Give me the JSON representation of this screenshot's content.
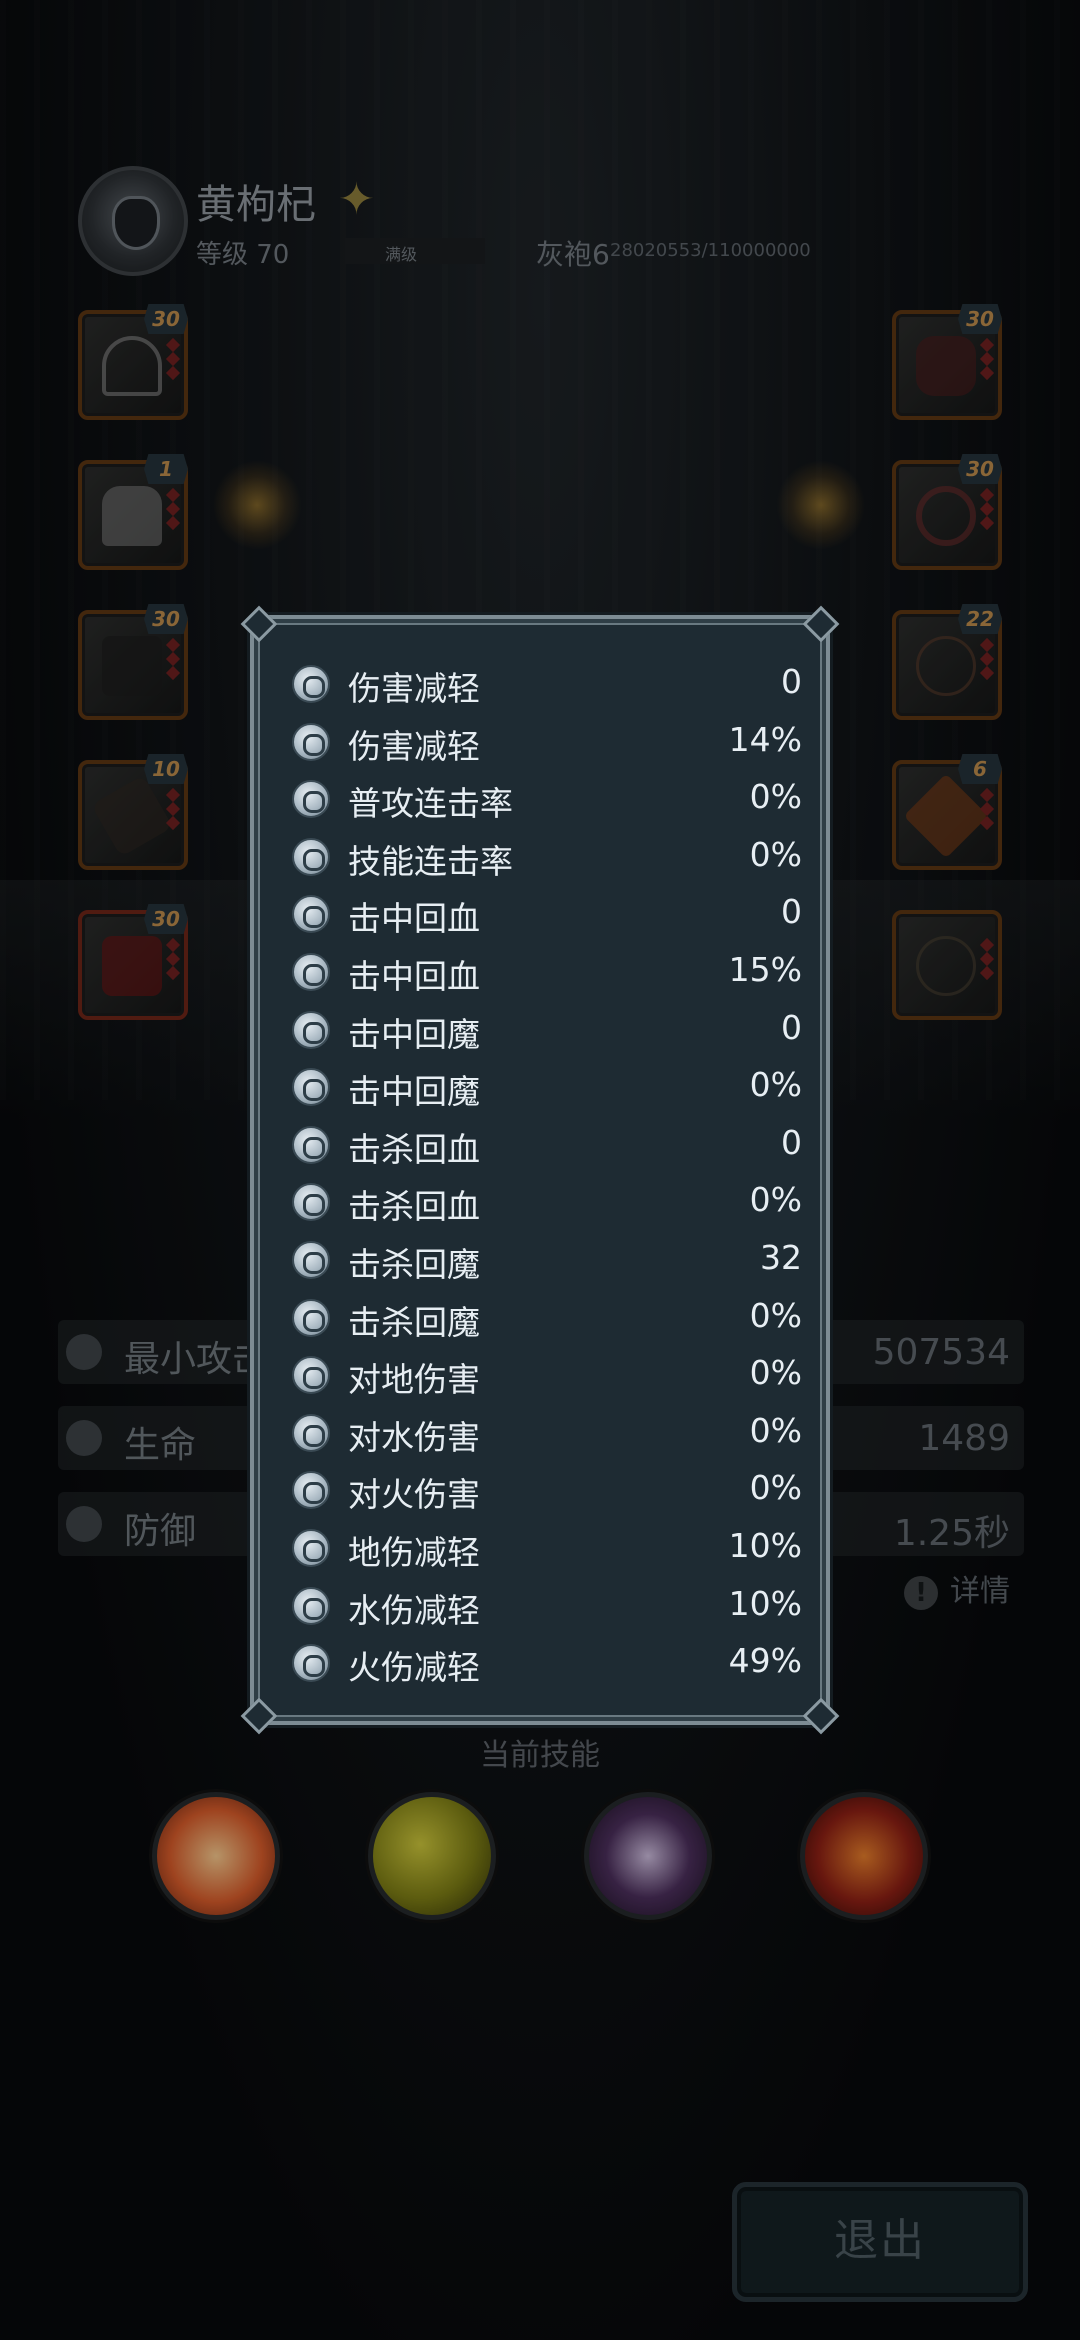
{
  "player": {
    "name": "黄枸杞",
    "level": "等级 70",
    "level_bar": "满级",
    "exp_label": "灰袍6",
    "exp_value": "28020553/110000000"
  },
  "equipment": {
    "left": [
      {
        "level": "30",
        "item": "hood-icon"
      },
      {
        "level": "1",
        "item": "character-icon"
      },
      {
        "level": "30",
        "item": "boots-icon"
      },
      {
        "level": "10",
        "item": "glove-icon"
      },
      {
        "level": "30",
        "item": "armor-icon"
      }
    ],
    "right": [
      {
        "level": "30",
        "item": "weapon-icon"
      },
      {
        "level": "30",
        "item": "ring-icon"
      },
      {
        "level": "22",
        "item": "necklace-icon"
      },
      {
        "level": "6",
        "item": "emblem-icon"
      },
      {
        "level": "",
        "item": "amulet-icon"
      }
    ]
  },
  "background_stats": [
    {
      "label": "最小攻击",
      "value": "507534",
      "icon": "sword-icon"
    },
    {
      "label": "生命",
      "value": "1489",
      "icon": "heart-icon"
    },
    {
      "label": "防御",
      "value": "1.25秒",
      "icon": "shield-icon"
    }
  ],
  "detail_label": "详情",
  "skills_title": "当前技能",
  "skills": [
    {
      "icon": "explosion-skill-icon",
      "color": "#c8502a"
    },
    {
      "icon": "bubbles-skill-icon",
      "color": "#6f7a14"
    },
    {
      "icon": "shadow-strike-skill-icon",
      "color": "#3a2a4a"
    },
    {
      "icon": "fire-shield-skill-icon",
      "color": "#7a1f14"
    }
  ],
  "exit_label": "退出",
  "attributes": [
    {
      "label": "伤害减轻",
      "value": "0",
      "icon": "armor-reduce-icon"
    },
    {
      "label": "伤害减轻",
      "value": "14%",
      "icon": "armor-reduce-icon"
    },
    {
      "label": "普攻连击率",
      "value": "0%",
      "icon": "combo-icon"
    },
    {
      "label": "技能连击率",
      "value": "0%",
      "icon": "skill-combo-icon"
    },
    {
      "label": "击中回血",
      "value": "0",
      "icon": "hit-heal-icon"
    },
    {
      "label": "击中回血",
      "value": "15%",
      "icon": "hit-heal-icon"
    },
    {
      "label": "击中回魔",
      "value": "0",
      "icon": "hit-mana-icon"
    },
    {
      "label": "击中回魔",
      "value": "0%",
      "icon": "hit-mana-icon"
    },
    {
      "label": "击杀回血",
      "value": "0",
      "icon": "kill-heal-icon"
    },
    {
      "label": "击杀回血",
      "value": "0%",
      "icon": "kill-heal-icon"
    },
    {
      "label": "击杀回魔",
      "value": "32",
      "icon": "kill-mana-icon"
    },
    {
      "label": "击杀回魔",
      "value": "0%",
      "icon": "kill-mana-icon"
    },
    {
      "label": "对地伤害",
      "value": "0%",
      "icon": "earth-icon"
    },
    {
      "label": "对水伤害",
      "value": "0%",
      "icon": "water-icon"
    },
    {
      "label": "对火伤害",
      "value": "0%",
      "icon": "fire-icon"
    },
    {
      "label": "地伤减轻",
      "value": "10%",
      "icon": "earth-resist-icon"
    },
    {
      "label": "水伤减轻",
      "value": "10%",
      "icon": "water-resist-icon"
    },
    {
      "label": "火伤减轻",
      "value": "49%",
      "icon": "fire-resist-icon"
    }
  ]
}
